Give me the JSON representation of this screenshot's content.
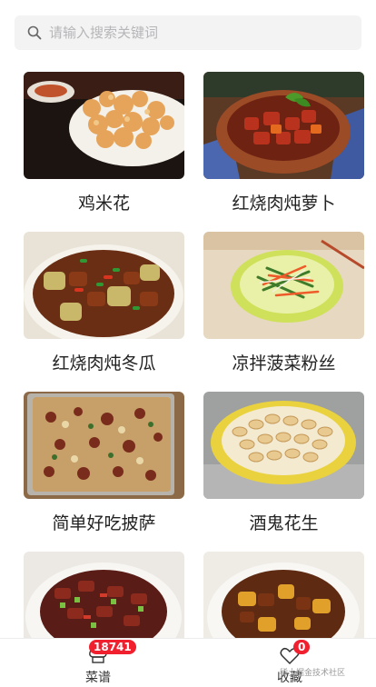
{
  "search": {
    "placeholder": "请输入搜索关键词",
    "value": "",
    "icon": "search-icon"
  },
  "recipes": [
    {
      "title": "鸡米花",
      "icon": "photo-popcorn-chicken"
    },
    {
      "title": "红烧肉炖萝卜",
      "icon": "photo-braised-pork-radish"
    },
    {
      "title": "红烧肉炖冬瓜",
      "icon": "photo-braised-pork-wintermelon"
    },
    {
      "title": "凉拌菠菜粉丝",
      "icon": "photo-spinach-vermicelli"
    },
    {
      "title": "简单好吃披萨",
      "icon": "photo-pizza"
    },
    {
      "title": "酒鬼花生",
      "icon": "photo-peanuts"
    },
    {
      "title": "",
      "icon": "photo-stir-fry-meat"
    },
    {
      "title": "",
      "icon": "photo-braised-meat-potato"
    }
  ],
  "tabbar": {
    "recipes": {
      "label": "菜谱",
      "badge": "18741",
      "icon": "chef-hat-icon"
    },
    "favorites": {
      "label": "收藏",
      "badge": "0",
      "icon": "heart-icon"
    }
  },
  "watermark": "稀土掘金技术社区",
  "colors": {
    "badge": "#f0202f",
    "search_bg": "#f3f3f4"
  }
}
